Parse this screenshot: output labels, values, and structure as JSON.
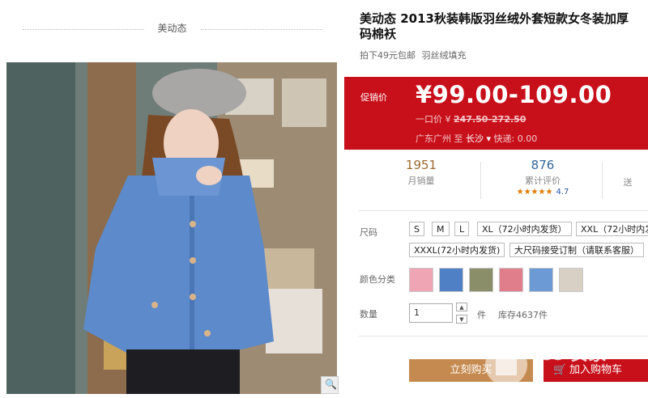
{
  "store": {
    "name": "美动态"
  },
  "product": {
    "title_line1": "美动态 2013秋装韩版羽丝绒外套短款女冬装加厚",
    "title_line2": "码棉袄",
    "tags": [
      "拍下49元包邮",
      "羽丝绒填充"
    ]
  },
  "price": {
    "label": "促销价",
    "value": "¥99.00-109.00",
    "orig_label": "一口价 ¥",
    "orig_value": "247.50-272.50",
    "ship_from": "广东广州",
    "ship_to_prefix": "至",
    "ship_to": "长沙",
    "ship_arrow": "▾",
    "ship_fee": "快递: 0.00"
  },
  "stats": {
    "sales": "1951",
    "sales_label": "月销量",
    "reviews": "876",
    "reviews_label": "累计评价",
    "stars": "★★★★★",
    "rating": "4.7",
    "third_label": "送"
  },
  "size": {
    "label": "尺码",
    "options": [
      "S",
      "M",
      "L",
      "XL（72小时内发货）",
      "XXL（72小时内发",
      "XXXL(72小时内发货)",
      "大尺码接受订制（请联系客服）"
    ]
  },
  "color": {
    "label": "颜色分类"
  },
  "qty": {
    "label": "数量",
    "value": "1",
    "unit": "件",
    "stock": "库存4637件",
    "up": "▲",
    "down": "▼"
  },
  "buttons": {
    "buy": "立刻购买",
    "cart": "加入购物车"
  },
  "watermark": {
    "text": "C8 安家"
  },
  "colors": {
    "price_red": "#c8101b",
    "buy_tan": "#c58a4f"
  },
  "icons": {
    "zoom": "magnifier-icon",
    "cart": "cart-icon"
  }
}
